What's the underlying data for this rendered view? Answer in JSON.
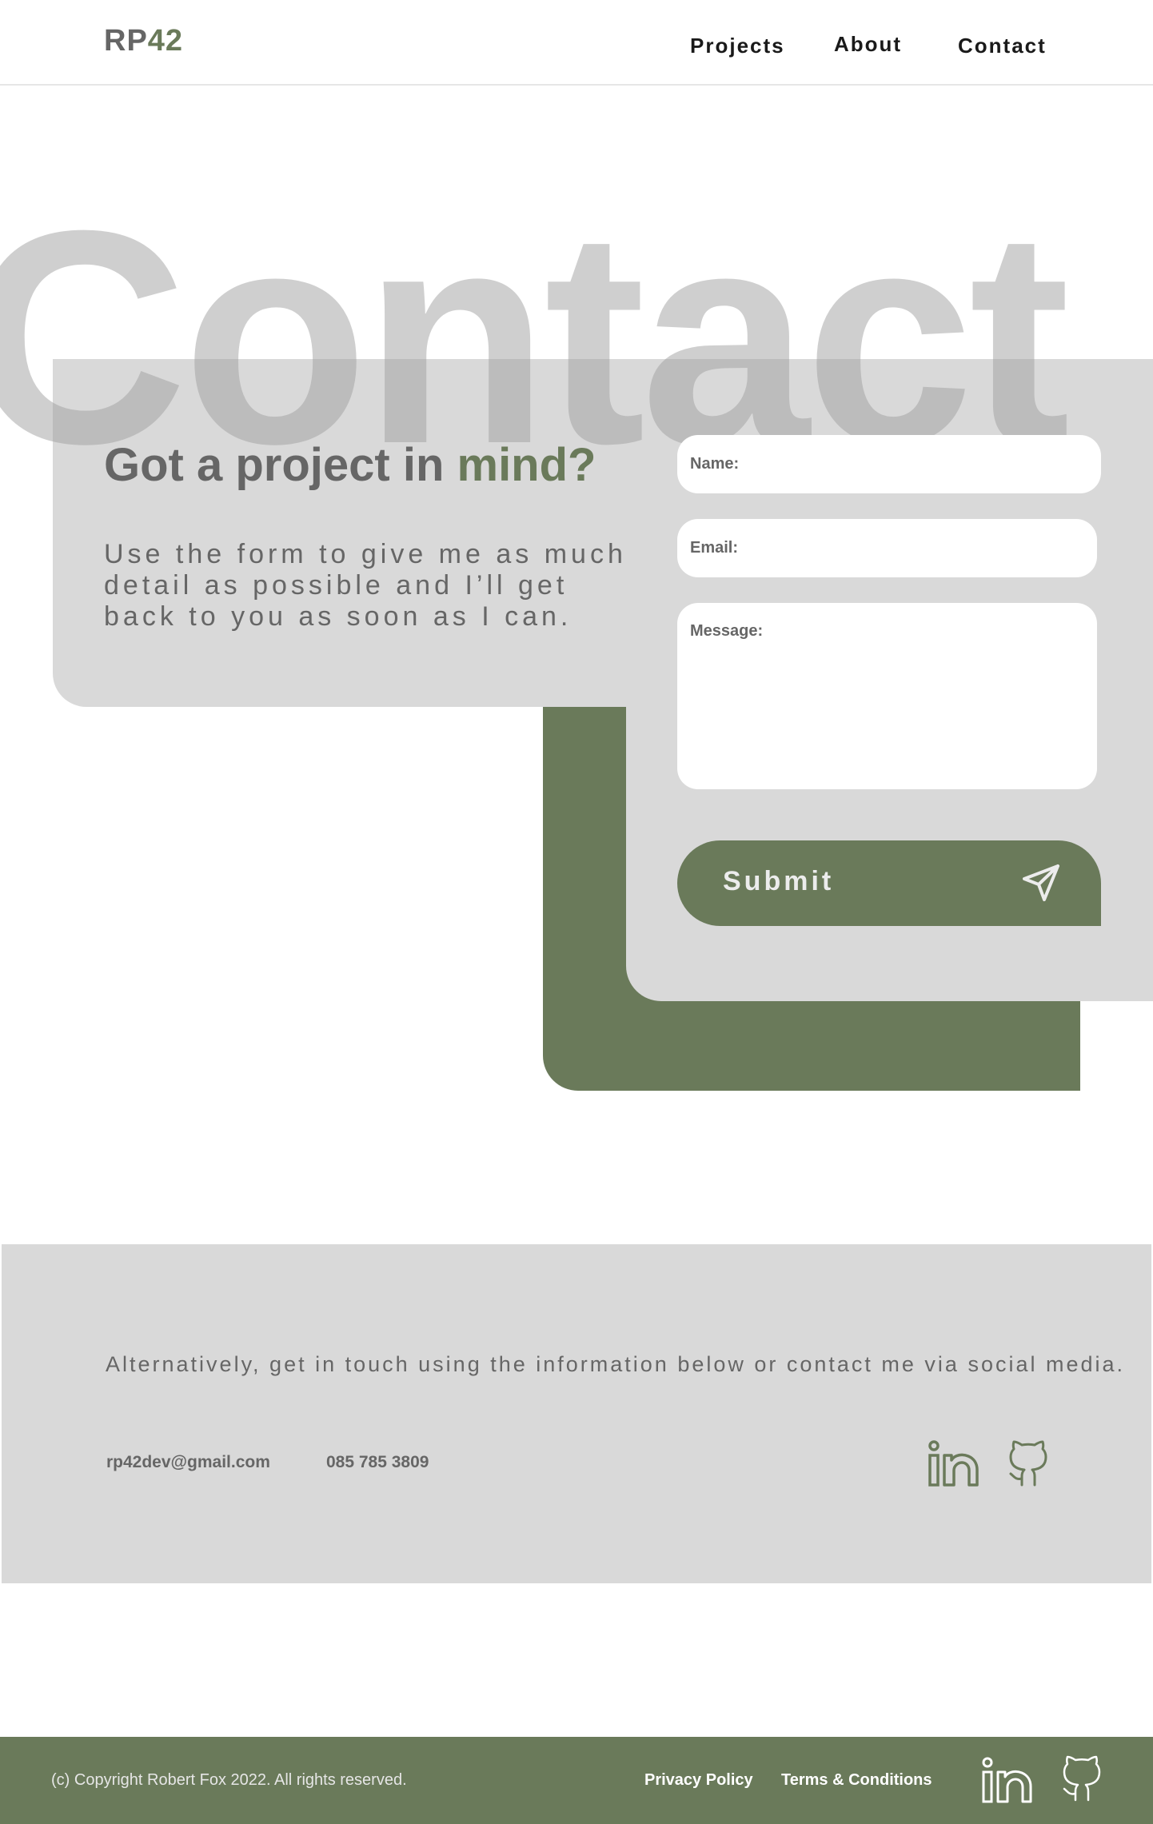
{
  "header": {
    "logo_prefix": "RP",
    "logo_suffix": "42",
    "nav": [
      "Projects",
      "About",
      "Contact"
    ]
  },
  "hero": {
    "background_word": "Contact",
    "headline_start": "Got a project in",
    "headline_accent": "mind?",
    "intro": "Use the form to give me as much detail as possible and I’ll get back to you as soon as I can."
  },
  "form": {
    "name_label": "Name:",
    "email_label": "Email:",
    "message_label": "Message:",
    "name_value": "",
    "email_value": "",
    "message_value": "",
    "submit_label": "Submit"
  },
  "contact_band": {
    "text": "Alternatively, get in touch using the information below or contact me via social media.",
    "email": "rp42dev@gmail.com",
    "phone": "085 785 3809",
    "icons": [
      "linkedin-icon",
      "github-icon"
    ]
  },
  "footer": {
    "copyright": "(c) Copyright Robert Fox 2022. All rights reserved.",
    "privacy": "Privacy Policy",
    "terms": "Terms & Conditions",
    "icons": [
      "linkedin-icon",
      "github-icon"
    ]
  },
  "colors": {
    "accent_green": "#6a7a5a",
    "panel_gray": "#d9d9d9",
    "text_gray": "#666666"
  }
}
